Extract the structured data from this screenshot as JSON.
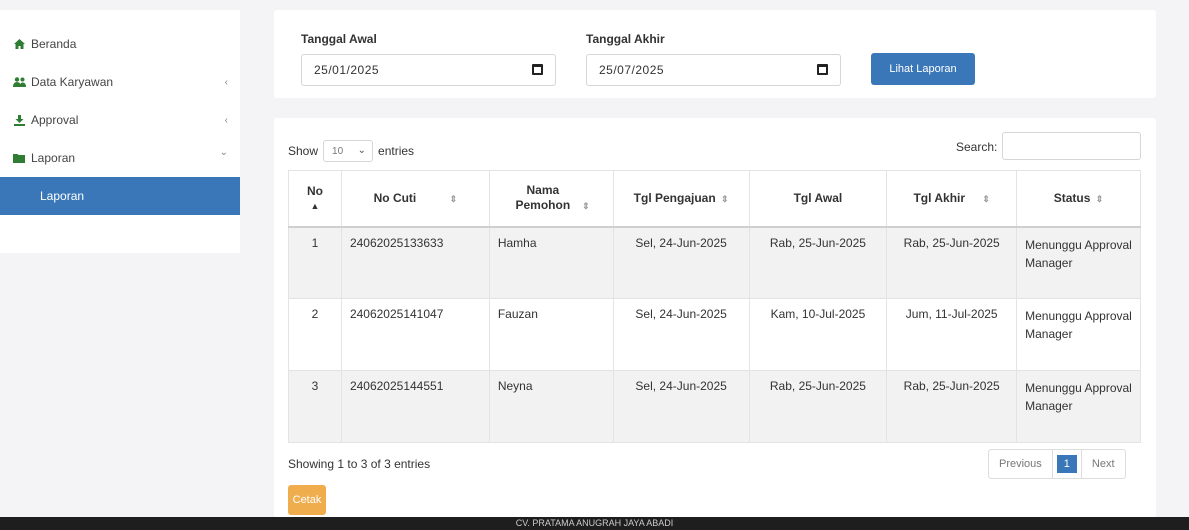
{
  "sidebar": {
    "items": [
      {
        "label": "Beranda",
        "icon": "home-icon"
      },
      {
        "label": "Data Karyawan",
        "icon": "users-icon"
      },
      {
        "label": "Approval",
        "icon": "download-icon"
      },
      {
        "label": "Laporan",
        "icon": "folder-icon"
      }
    ],
    "sub_item": "Laporan",
    "chev_left": "‹",
    "chev_down": "⌄"
  },
  "filter": {
    "start_label": "Tanggal Awal",
    "start_value": "25/01/2025",
    "end_label": "Tanggal Akhir",
    "end_value": "25/07/2025",
    "button_label": "Lihat Laporan"
  },
  "table_controls": {
    "show_label": "Show",
    "entries_value": "10",
    "entries_label": "entries",
    "search_label": "Search:"
  },
  "table": {
    "headers": [
      "No",
      "No Cuti",
      "Nama Pemohon",
      "Tgl Pengajuan",
      "Tgl Awal",
      "Tgl Akhir",
      "Status"
    ],
    "rows": [
      {
        "no": "1",
        "no_cuti": "24062025133633",
        "nama": "Hamha",
        "tgl_pengajuan": "Sel, 24-Jun-2025",
        "tgl_awal": "Rab, 25-Jun-2025",
        "tgl_akhir": "Rab, 25-Jun-2025",
        "status": "Menunggu Approval Manager"
      },
      {
        "no": "2",
        "no_cuti": "24062025141047",
        "nama": "Fauzan",
        "tgl_pengajuan": "Sel, 24-Jun-2025",
        "tgl_awal": "Kam, 10-Jul-2025",
        "tgl_akhir": "Jum, 11-Jul-2025",
        "status": "Menunggu Approval Manager"
      },
      {
        "no": "3",
        "no_cuti": "24062025144551",
        "nama": "Neyna",
        "tgl_pengajuan": "Sel, 24-Jun-2025",
        "tgl_awal": "Rab, 25-Jun-2025",
        "tgl_akhir": "Rab, 25-Jun-2025",
        "status": "Menunggu Approval Manager"
      }
    ]
  },
  "info": "Showing 1 to 3 of 3 entries",
  "pagination": {
    "previous": "Previous",
    "current": "1",
    "next": "Next"
  },
  "print_button": "Cetak",
  "footer": "CV. PRATAMA ANUGRAH JAYA ABADI",
  "colors": {
    "primary": "#3a77b8",
    "warning": "#f0ad4e",
    "icon_green": "#2e7d32"
  }
}
